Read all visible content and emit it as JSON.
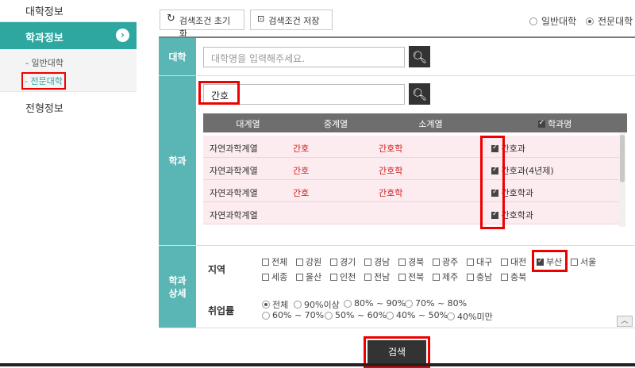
{
  "sidebar": {
    "top": "대학정보",
    "active": "학과정보",
    "sub": [
      "- 일반대학",
      "- 전문대학"
    ],
    "bottom": "전형정보"
  },
  "toolbar": {
    "reset": "검색조건 초기화",
    "save": "검색조건 저장",
    "radio_general": "일반대학",
    "radio_college": "전문대학"
  },
  "form": {
    "univ_label": "대학",
    "univ_placeholder": "대학명을 입력해주세요.",
    "dept_label": "학과",
    "dept_value": "간호",
    "detail_label_1": "학과",
    "detail_label_2": "상세"
  },
  "table": {
    "headers": [
      "대계열",
      "중계열",
      "소계열",
      "학과명"
    ],
    "rows": [
      {
        "c1": "자연과학계열",
        "c2": "간호",
        "c3": "간호학",
        "c4": "간호과"
      },
      {
        "c1": "자연과학계열",
        "c2": "간호",
        "c3": "간호학",
        "c4": "간호과(4년제)"
      },
      {
        "c1": "자연과학계열",
        "c2": "간호",
        "c3": "간호학",
        "c4": "간호학과"
      },
      {
        "c1": "자연과학계열",
        "c2": "",
        "c3": "",
        "c4": "간호학과"
      }
    ]
  },
  "region": {
    "label": "지역",
    "items": [
      "전체",
      "강원",
      "경기",
      "경남",
      "경북",
      "광주",
      "대구",
      "대전",
      "부산",
      "서울",
      "세종",
      "울산",
      "인천",
      "전남",
      "전북",
      "제주",
      "충남",
      "충북"
    ]
  },
  "employment": {
    "label": "취업률",
    "items": [
      "전체",
      "90%이상",
      "80% ~ 90%",
      "70% ~ 80%",
      "60% ~ 70%",
      "50% ~ 60%",
      "40% ~ 50%",
      "40%미만"
    ]
  },
  "search_button": "검색",
  "colors": {
    "accent": "#2ea7a0",
    "label_bg": "#5ab5b5",
    "highlight": "#ee0000"
  }
}
